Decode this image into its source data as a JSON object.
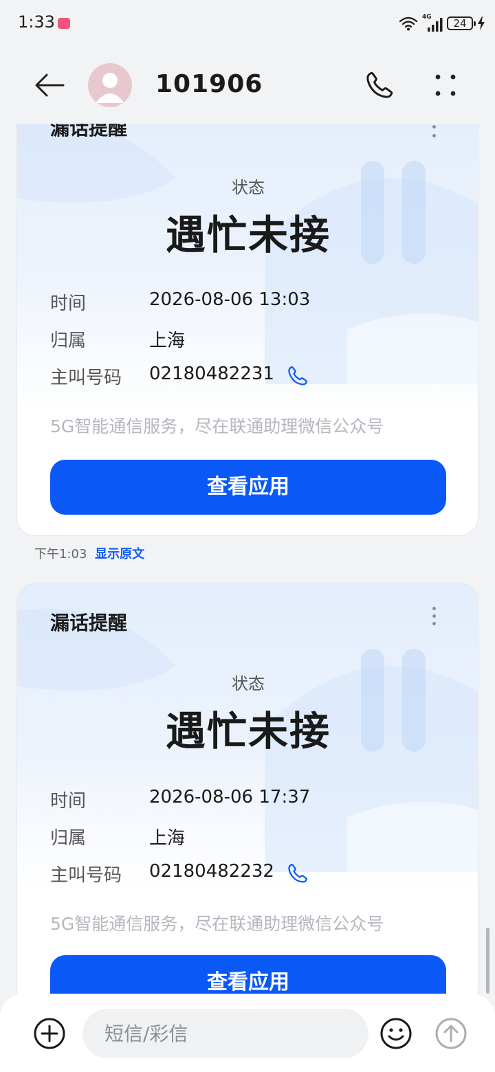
{
  "status_bar": {
    "time": "1:33",
    "network": "4G",
    "battery": "24"
  },
  "header": {
    "title": "101906"
  },
  "messages": [
    {
      "card_title": "漏话提醒",
      "status_label": "状态",
      "status_value": "遇忙未接",
      "rows": [
        {
          "key": "时间",
          "value": "2026-08-06 13:03"
        },
        {
          "key": "归属",
          "value": "上海"
        },
        {
          "key": "主叫号码",
          "value": "02180482231"
        }
      ],
      "promo": "5G智能通信服务，尽在联通助理微信公众号",
      "button_label": "查看应用",
      "sent_time": "下午1:03",
      "show_original_label": "显示原文"
    },
    {
      "card_title": "漏话提醒",
      "status_label": "状态",
      "status_value": "遇忙未接",
      "rows": [
        {
          "key": "时间",
          "value": "2026-08-06 17:37"
        },
        {
          "key": "归属",
          "value": "上海"
        },
        {
          "key": "主叫号码",
          "value": "02180482232"
        }
      ],
      "promo": "5G智能通信服务，尽在联通助理微信公众号",
      "button_label": "查看应用"
    }
  ],
  "compose": {
    "placeholder": "短信/彩信"
  },
  "colors": {
    "accent": "#0a59f7",
    "card_gradient_top": "#e3eefc",
    "background": "#f1f3f5"
  },
  "icons": [
    "back-arrow-icon",
    "avatar-person-icon",
    "phone-icon",
    "more-dots-icon",
    "kebab-menu-icon",
    "plus-circle-icon",
    "emoji-icon",
    "send-arrow-icon"
  ]
}
